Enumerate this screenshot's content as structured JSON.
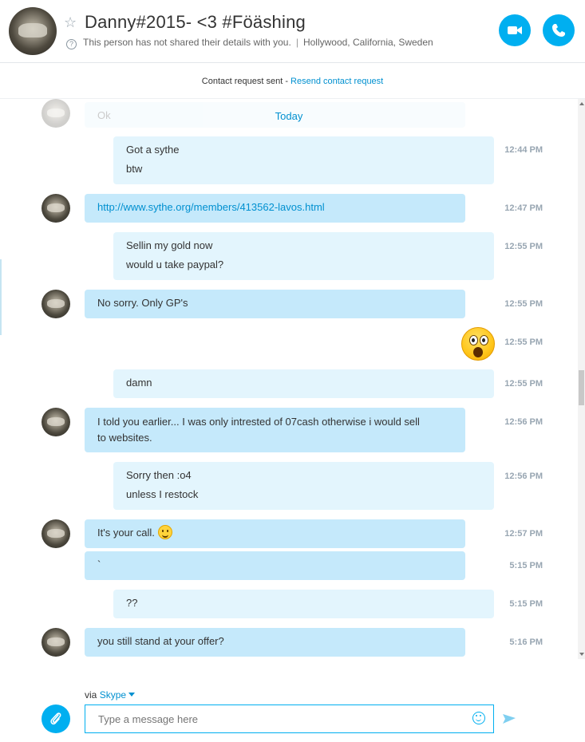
{
  "header": {
    "contact_name": "Danny#2015- <3 #Föäshing",
    "info_text": "This person has not shared their details with you.",
    "separator": "|",
    "location": "Hollywood, California, Sweden",
    "video_call_icon": "video-camera-icon",
    "audio_call_icon": "phone-icon"
  },
  "request_bar": {
    "status": "Contact request sent - ",
    "resend_link": "Resend contact request"
  },
  "chat": {
    "faded_message": "Ok",
    "date_divider": "Today",
    "messages": [
      {
        "dir": "out",
        "lines": [
          "Got a sythe",
          "btw"
        ],
        "time": "12:44 PM"
      },
      {
        "dir": "in",
        "lines": [
          "http://www.sythe.org/members/413562-lavos.html"
        ],
        "time": "12:47 PM",
        "is_link": true
      },
      {
        "dir": "out",
        "lines": [
          "Sellin my gold now",
          "would u take paypal?"
        ],
        "time": "12:55 PM"
      },
      {
        "dir": "in",
        "lines": [
          "No sorry. Only GP's"
        ],
        "time": "12:55 PM"
      },
      {
        "dir": "out",
        "emoji": "surprised-emoticon",
        "time": "12:55 PM"
      },
      {
        "dir": "out",
        "lines": [
          "damn"
        ],
        "time": "12:55 PM"
      },
      {
        "dir": "in",
        "lines": [
          "I told you earlier... I was only intrested of 07cash otherwise i would sell",
          "to websites."
        ],
        "time": "12:56 PM"
      },
      {
        "dir": "out",
        "lines": [
          "Sorry then :o4",
          "unless I restock"
        ],
        "time": "12:56 PM"
      },
      {
        "dir": "in",
        "lines": [
          "It's your call."
        ],
        "emoji": "smile-emoticon",
        "time": "12:57 PM"
      },
      {
        "dir": "in",
        "lines": [
          "`"
        ],
        "time": "5:15 PM"
      },
      {
        "dir": "out",
        "lines": [
          "??"
        ],
        "time": "5:15 PM"
      },
      {
        "dir": "in",
        "lines": [
          "you still stand at your offer?"
        ],
        "time": "5:16 PM"
      }
    ]
  },
  "composer": {
    "via_label": "via",
    "service": "Skype",
    "placeholder": "Type a message here",
    "attach_icon": "paperclip-icon",
    "emoticon_icon": "smiley-icon",
    "send_icon": "send-arrow-icon"
  },
  "colors": {
    "accent": "#00aff0",
    "incoming_bubble": "#c5e9fb",
    "outgoing_bubble": "#e3f5fd",
    "link": "#0090d0"
  }
}
